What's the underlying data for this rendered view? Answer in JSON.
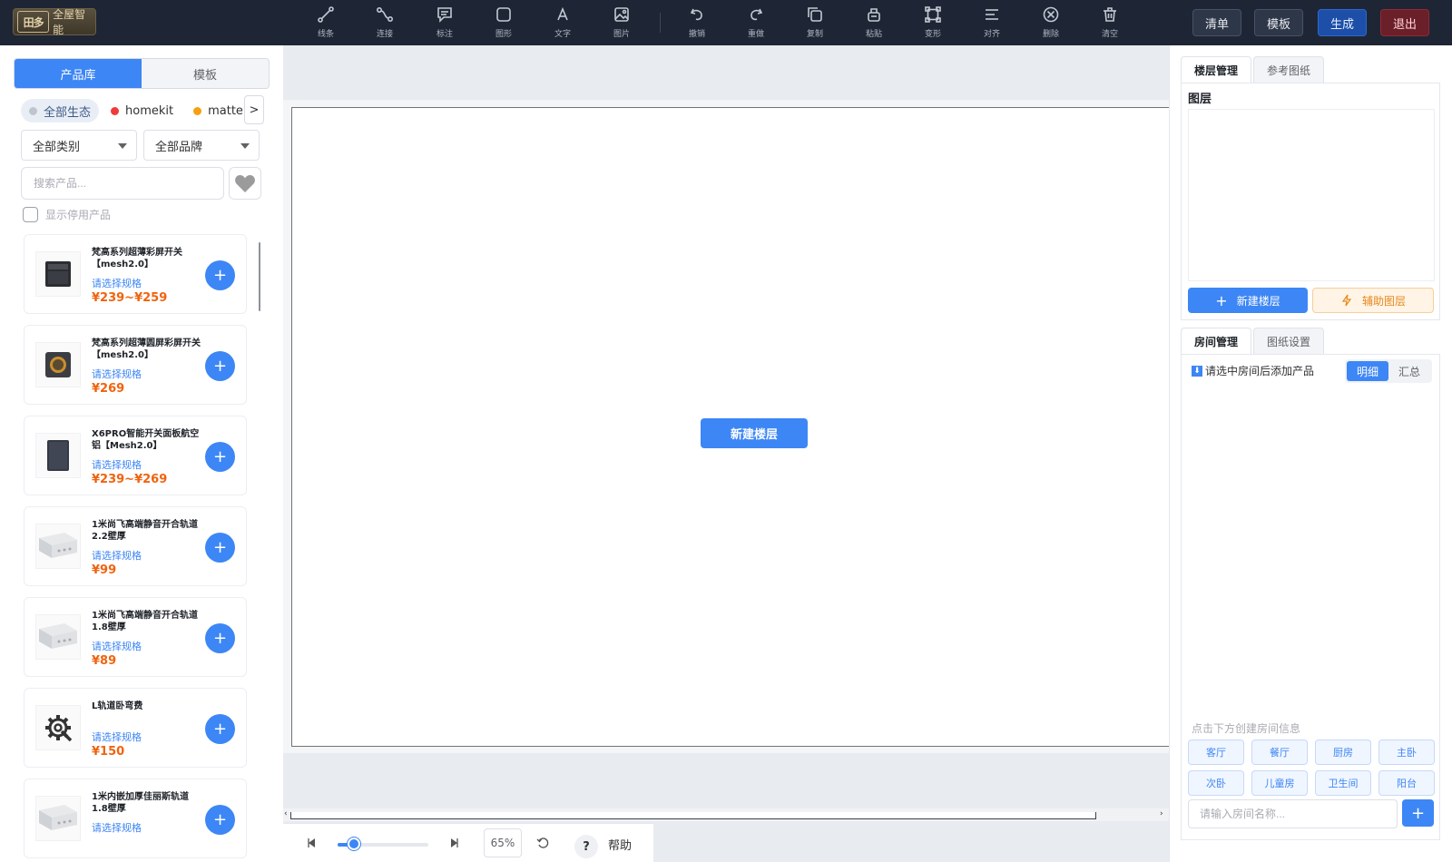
{
  "header": {
    "logo_mark": "田多",
    "logo_text": "全屋智能",
    "tools": [
      {
        "label": "线条",
        "icon": "line-icon"
      },
      {
        "label": "连接",
        "icon": "connect-icon"
      },
      {
        "label": "标注",
        "icon": "annotation-icon"
      },
      {
        "label": "图形",
        "icon": "shape-icon"
      },
      {
        "label": "文字",
        "icon": "text-icon"
      },
      {
        "label": "图片",
        "icon": "image-icon"
      },
      {
        "label": "撤销",
        "icon": "undo-icon"
      },
      {
        "label": "重做",
        "icon": "redo-icon"
      },
      {
        "label": "复制",
        "icon": "copy-icon"
      },
      {
        "label": "粘贴",
        "icon": "paste-icon"
      },
      {
        "label": "变形",
        "icon": "transform-icon"
      },
      {
        "label": "对齐",
        "icon": "align-icon"
      },
      {
        "label": "删除",
        "icon": "delete-icon"
      },
      {
        "label": "清空",
        "icon": "clear-icon"
      }
    ],
    "buttons": {
      "list": "清单",
      "template": "模板",
      "generate": "生成",
      "exit": "退出"
    }
  },
  "left_panel": {
    "tabs": [
      "产品库",
      "模板"
    ],
    "ecosystems": [
      {
        "label": "全部生态",
        "color": "#c0c4cc"
      },
      {
        "label": "homekit",
        "color": "#f03a3a"
      },
      {
        "label": "matter",
        "color": "#f5a00f"
      }
    ],
    "eco_next": ">",
    "category_select": "全部类别",
    "brand_select": "全部品牌",
    "search_placeholder": "搜索产品...",
    "show_disabled_label": "显示停用产品",
    "products": [
      {
        "name": "梵高系列超薄彩屏开关【mesh2.0】",
        "spec": "请选择规格",
        "price": "¥239~¥259",
        "image": "panel-switch-icon"
      },
      {
        "name": "梵高系列超薄圆屏彩屏开关【mesh2.0】",
        "spec": "请选择规格",
        "price": "¥269",
        "image": "round-screen-switch-icon"
      },
      {
        "name": "X6PRO智能开关面板航空铝【Mesh2.0】",
        "spec": "请选择规格",
        "price": "¥239~¥269",
        "image": "aluminum-panel-icon"
      },
      {
        "name": "1米尚飞高端静音开合轨道2.2壁厚",
        "spec": "请选择规格",
        "price": "¥99",
        "image": "curtain-track-icon"
      },
      {
        "name": "1米尚飞高端静音开合轨道1.8壁厚",
        "spec": "请选择规格",
        "price": "¥89",
        "image": "curtain-track-icon"
      },
      {
        "name": "L轨道卧弯费",
        "spec": "请选择规格",
        "price": "¥150",
        "image": "service-gear-icon"
      },
      {
        "name": "1米内嵌加厚佳丽斯轨道1.8壁厚",
        "spec": "请选择规格",
        "price": "",
        "image": "curtain-track-icon"
      }
    ]
  },
  "canvas": {
    "new_floor_button": "新建楼层",
    "zoom": "65%",
    "zoom_level": 0.18,
    "help_icon_text": "?",
    "help_label": "帮助"
  },
  "right_panel": {
    "top_tabs": [
      "楼层管理",
      "参考图纸"
    ],
    "layers_title": "图层",
    "new_floor_button": "新建楼层",
    "aux_layer_button": "辅助图层",
    "bottom_tabs": [
      "房间管理",
      "图纸设置"
    ],
    "hint": "请选中房间后添加产品",
    "hint_icon": "⬇",
    "view_toggle": [
      "明细",
      "汇总"
    ],
    "room_hint": "点击下方创建房间信息",
    "rooms": [
      "客厅",
      "餐厅",
      "厨房",
      "主卧",
      "次卧",
      "儿童房",
      "卫生间",
      "阳台"
    ],
    "room_input_placeholder": "请输入房间名称...",
    "room_add": "+"
  }
}
